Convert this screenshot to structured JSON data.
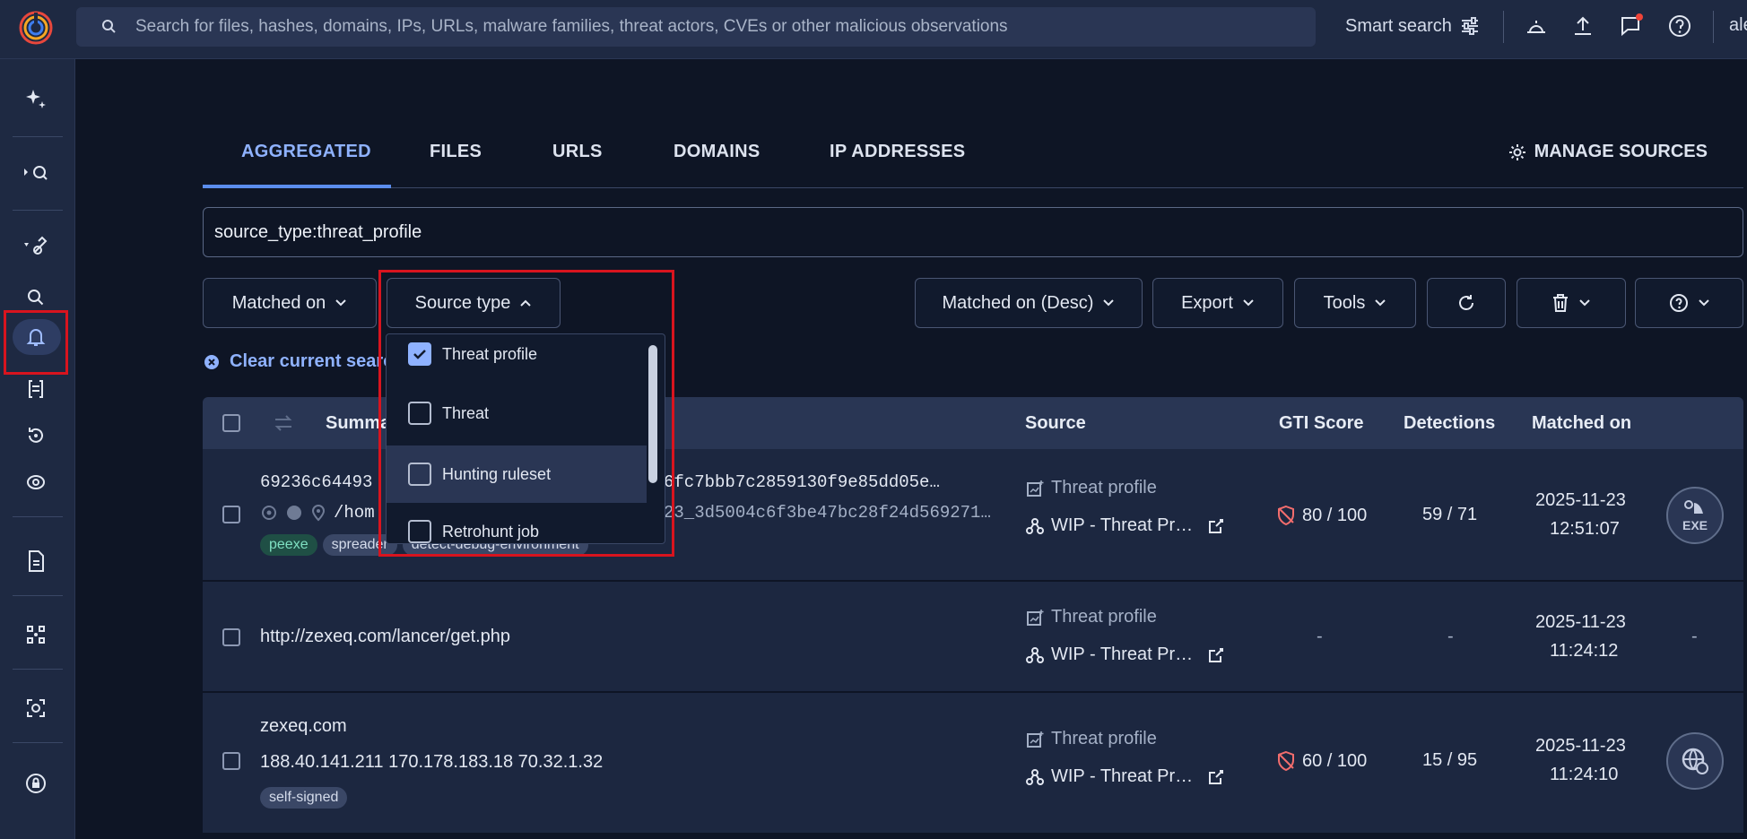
{
  "topbar": {
    "search_placeholder": "Search for files, hashes, domains, IPs, URLs, malware families, threat actors, CVEs or other malicious observations",
    "smart_search": "Smart search",
    "user_initials": "ale"
  },
  "tabs": [
    {
      "label": "AGGREGATED",
      "active": true
    },
    {
      "label": "FILES"
    },
    {
      "label": "URLS"
    },
    {
      "label": "DOMAINS"
    },
    {
      "label": "IP ADDRESSES"
    }
  ],
  "manage_sources": "MANAGE SOURCES",
  "query": "source_type:threat_profile",
  "filters": {
    "matched_on": "Matched on",
    "source_type": "Source type",
    "sort": "Matched on (Desc)",
    "export": "Export",
    "tools": "Tools"
  },
  "clear_search": "Clear current search",
  "dropdown": {
    "items": [
      {
        "label": "Threat profile",
        "checked": true
      },
      {
        "label": "Threat",
        "checked": false
      },
      {
        "label": "Hunting ruleset",
        "checked": false
      },
      {
        "label": "Retrohunt job",
        "checked": false
      }
    ]
  },
  "table": {
    "headers": {
      "summary": "Summary",
      "source": "Source",
      "gti_score": "GTI Score",
      "detections": "Detections",
      "matched_on": "Matched on"
    },
    "rows": [
      {
        "line1": "69236c64493",
        "line1_tail": "6fc7bbb7c2859130f9e85dd05e…",
        "line2": "/hom",
        "line2_tail": "23_3d5004c6f3be47bc28f24d569271…",
        "tags": [
          "peexe",
          "spreader",
          "detect-debug-environment"
        ],
        "source_type": "Threat profile",
        "source_name": "WIP - Threat Pr…",
        "gti": "80 / 100",
        "detections": "59 / 71",
        "date": "2025-11-23",
        "time": "12:51:07",
        "icon_label": "EXE"
      },
      {
        "line1": "http://zexeq.com/lancer/get.php",
        "source_type": "Threat profile",
        "source_name": "WIP - Threat Pr…",
        "gti": "-",
        "detections": "-",
        "date": "2025-11-23",
        "time": "11:24:12",
        "icon_label": "-"
      },
      {
        "line1": "zexeq.com",
        "line2": "188.40.141.211  170.178.183.18  70.32.1.32",
        "tags": [
          "self-signed"
        ],
        "source_type": "Threat profile",
        "source_name": "WIP - Threat Pr…",
        "gti": "60 / 100",
        "detections": "15 / 95",
        "date": "2025-11-23",
        "time": "11:24:10"
      }
    ]
  },
  "colors": {
    "accent": "#8fb2ff",
    "highlight_box": "#d8141e",
    "danger": "#f26d6d",
    "tag_green": "#7fe0c2"
  }
}
